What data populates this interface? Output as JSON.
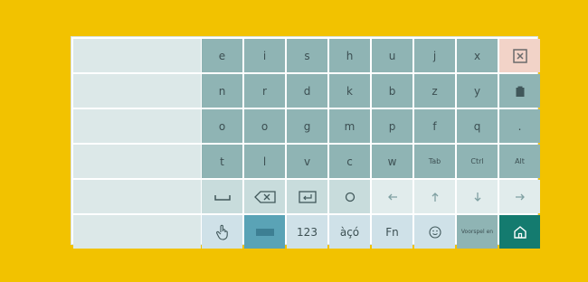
{
  "keyboard": {
    "rows": [
      [
        "e",
        "i",
        "s",
        "h",
        "u",
        "j",
        "x",
        ""
      ],
      [
        "n",
        "r",
        "d",
        "k",
        "b",
        "z",
        "y",
        ""
      ],
      [
        "o",
        "o",
        "g",
        "m",
        "p",
        "f",
        "q",
        "."
      ],
      [
        "t",
        "l",
        "v",
        "c",
        "w",
        "Tab",
        "Ctrl",
        "Alt"
      ],
      [
        "",
        "",
        "",
        "",
        "",
        "",
        "",
        ""
      ],
      [
        "",
        "",
        "123",
        "àçó",
        "Fn",
        "",
        "Voorspel en",
        ""
      ]
    ]
  },
  "colors": {
    "background": "#f2c200",
    "key": "#8fb4b4",
    "special_key": "#c8dcdc",
    "arrow_key": "#e1ecec",
    "home_key": "#147b6f",
    "close_key": "#f2d3c8"
  }
}
